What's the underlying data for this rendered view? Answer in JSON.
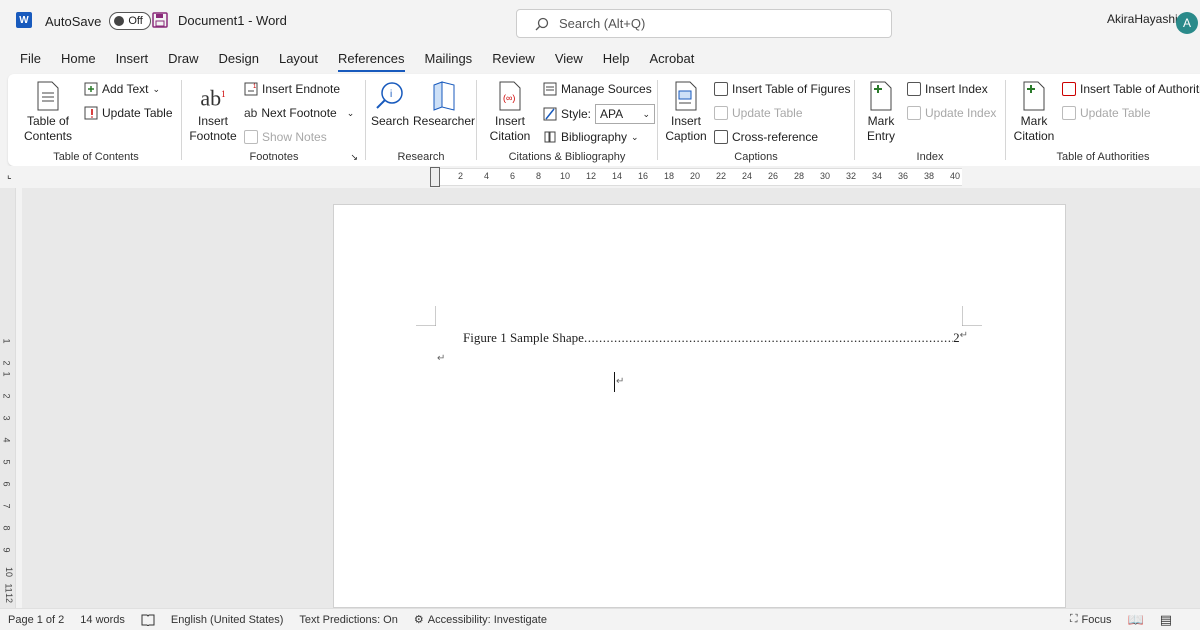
{
  "titlebar": {
    "autosave_label": "AutoSave",
    "autosave_state": "Off",
    "document_title": "Document1 - Word",
    "search_placeholder": "Search (Alt+Q)",
    "user_name": "AkiraHayashi",
    "avatar_initial": "A"
  },
  "menu": {
    "items": [
      "File",
      "Home",
      "Insert",
      "Draw",
      "Design",
      "Layout",
      "References",
      "Mailings",
      "Review",
      "View",
      "Help",
      "Acrobat"
    ],
    "active": "References"
  },
  "ribbon": {
    "toc": {
      "label": "Table of Contents",
      "table_of_contents": "Table of\nContents",
      "add_text": "Add Text",
      "update_table": "Update Table"
    },
    "footnotes": {
      "label": "Footnotes",
      "insert_footnote": "Insert\nFootnote",
      "insert_endnote": "Insert Endnote",
      "next_footnote": "Next Footnote",
      "show_notes": "Show Notes"
    },
    "research": {
      "label": "Research",
      "search": "Search",
      "researcher": "Researcher"
    },
    "citations": {
      "label": "Citations & Bibliography",
      "insert_citation": "Insert\nCitation",
      "manage_sources": "Manage Sources",
      "style_label": "Style:",
      "style_value": "APA",
      "bibliography": "Bibliography"
    },
    "captions": {
      "label": "Captions",
      "insert_caption": "Insert\nCaption",
      "insert_table_of_figures": "Insert Table of Figures",
      "update_table": "Update Table",
      "cross_reference": "Cross-reference"
    },
    "index": {
      "label": "Index",
      "mark_entry": "Mark\nEntry",
      "insert_index": "Insert Index",
      "update_index": "Update Index"
    },
    "authorities": {
      "label": "Table of Authorities",
      "mark_citation": "Mark\nCitation",
      "insert_table_of_authorities": "Insert Table of Authorities",
      "update_table": "Update Table"
    }
  },
  "ruler": {
    "ticks": [
      "2",
      "4",
      "6",
      "8",
      "10",
      "12",
      "14",
      "16",
      "18",
      "20",
      "22",
      "24",
      "26",
      "28",
      "30",
      "32",
      "34",
      "36",
      "38",
      "40"
    ],
    "vticks": [
      "1",
      "2",
      "1",
      "2",
      "3",
      "4",
      "5",
      "6",
      "7",
      "8",
      "9",
      "10",
      "11",
      "12"
    ]
  },
  "document": {
    "toc_entry_text": "Figure 1 Sample Shape",
    "toc_entry_page": "2",
    "para_mark": "↵"
  },
  "status": {
    "page": "Page 1 of 2",
    "words": "14 words",
    "language": "English (United States)",
    "text_predictions": "Text Predictions: On",
    "accessibility": "Accessibility: Investigate",
    "focus": "Focus"
  },
  "colors": {
    "word_blue": "#185abd",
    "avatar_teal": "#2a8a8a"
  }
}
